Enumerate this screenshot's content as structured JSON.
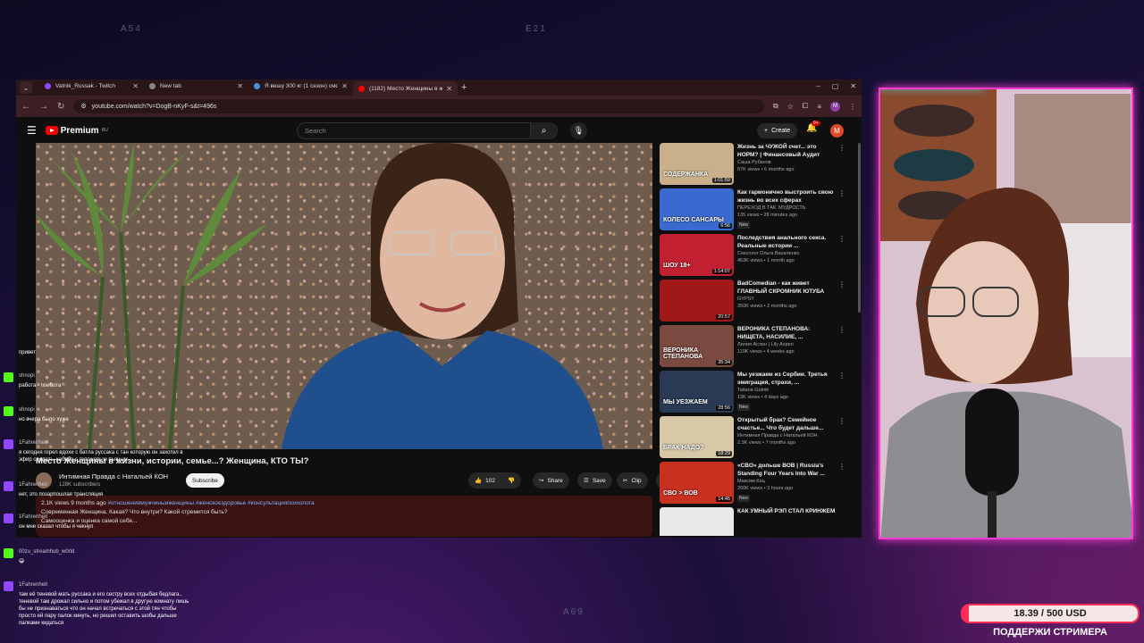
{
  "watermarks": {
    "top_left": "A54",
    "top_center": "E21",
    "bottom": "A69"
  },
  "browser": {
    "tabs": [
      {
        "label": "Vatnik_Russak - Twitch",
        "color": "#9146ff"
      },
      {
        "label": "New tab",
        "color": "#888888"
      },
      {
        "label": "Я вешу 300 кг (1 сезон) смотр",
        "color": "#4a90e2"
      },
      {
        "label": "(1182) Место Женщины в жи",
        "color": "#ff0000"
      }
    ],
    "url": "youtube.com/watch?v=DogB-nKyF-s&t=496s"
  },
  "youtube": {
    "logo": "Premium",
    "logo_sup": "RU",
    "search_placeholder": "Search",
    "create_label": "Create",
    "notif_count": "9+",
    "account_letter": "M"
  },
  "video": {
    "title": "Место Женщины в жизни, истории, семье...? Женщина, КТО ТЫ?",
    "channel": "Интимная Правда с Натальей КОН",
    "subscribers": "128K subscribers",
    "subscribe_label": "Subscribe",
    "likes": "102",
    "share_label": "Share",
    "save_label": "Save",
    "clip_label": "Clip",
    "desc_stats": "2.1K views  9 months ago",
    "desc_tags": "#отношениямужчиныиженщины #женскоездоровье #консультацияпсихолога",
    "desc_line1": "Современная Женщина. Какая? Что внутри? Какой стремится быть?",
    "desc_line2": "Самооценка и оценка самой себя..."
  },
  "related": [
    {
      "title": "Жизнь за ЧУЖОЙ счет... это НОРМ? | Финансовый Аудит",
      "channel": "Саша Рубанов",
      "views": "57K views • 6 months ago",
      "duration": "1:01:59",
      "thumb_text": "СОДЕРЖАНКА",
      "bg": "#c9b08a",
      "new": false
    },
    {
      "title": "Как гармонично выстроить свою жизнь во всех сферах",
      "channel": "ПЕРЕХОД В ТАК. МУДРОСТЬ",
      "views": "135 views • 28 minutes ago",
      "duration": "6:56",
      "thumb_text": "КОЛЕСО САНСАРЫ",
      "bg": "#3a6ad0",
      "new": true
    },
    {
      "title": "Последствия анального секса. Реальные истории ...",
      "channel": "Сексолог Ольга Василенко",
      "views": "453K views • 1 month ago",
      "duration": "1:14:07",
      "thumb_text": "ШОУ 18+",
      "bg": "#c02030",
      "new": false
    },
    {
      "title": "BadComedian - как живет ГЛАВНЫЙ СКРОМНИК ЮТУБА",
      "channel": "GYPSY",
      "views": "350K views • 2 months ago",
      "duration": "20:57",
      "thumb_text": "",
      "bg": "#a01818",
      "new": false
    },
    {
      "title": "ВЕРОНИКА СТЕПАНОВА: НИЩЕТА, НАСИЛИЕ, ...",
      "channel": "Лилия Аслен | Lily Aspen",
      "views": "110K views • 4 weeks ago",
      "duration": "35:34",
      "thumb_text": "ВЕРОНИКА СТЕПАНОВА",
      "bg": "#7a4a40",
      "new": false
    },
    {
      "title": "Мы уезжаем из Сербии. Третья эмиграция, страхи, ...",
      "channel": "Tatiana Gutnik",
      "views": "13K views • 4 days ago",
      "duration": "28:56",
      "thumb_text": "МЫ УЕЗЖАЕМ",
      "bg": "#2a3a55",
      "new": true
    },
    {
      "title": "Открытый брак? Семейное счастье... Что будет дальше...",
      "channel": "Интимная Правда с Натальей КОН",
      "views": "2.3K views • 7 months ago",
      "duration": "18:29",
      "thumb_text": "БРАК НАДО?",
      "bg": "#d8c8a8",
      "new": false
    },
    {
      "title": "«СВО» дольше ВОВ | Russia's Standing Four Years Into War ...",
      "channel": "Максим Кац",
      "views": "200K views • 3 hours ago",
      "duration": "14:45",
      "thumb_text": "СВО > ВОВ",
      "bg": "#c83020",
      "new": true
    },
    {
      "title": "КАК УМНЫЙ РЭП СТАЛ КРИНЖЕМ",
      "channel": "",
      "views": "",
      "duration": "",
      "thumb_text": "",
      "bg": "#e8e8e8",
      "new": false
    }
  ],
  "chat": [
    {
      "user": "",
      "text": "привет",
      "badge": "none"
    },
    {
      "user": "shnopi",
      "text": "работа - поебота",
      "badge": "kick"
    },
    {
      "user": "shnopi",
      "text": "но вчера было хуже",
      "badge": "kick"
    },
    {
      "user": "1Fahrenheit",
      "text": "я сегодня горел вдохи с батла руссака с тан которую он захотел в эфир сделать, кабаба с голожопым пьяным...",
      "badge": "twitch"
    },
    {
      "user": "1Fahrenheit",
      "text": "нет, это позарпошлая трансляция",
      "badge": "twitch"
    },
    {
      "user": "1Fahrenheit",
      "text": "он мне сказал чтобы я чекнул",
      "badge": "twitch"
    },
    {
      "user": "00zu_streamhub_w0rld",
      "text": "😁",
      "badge": "kick"
    },
    {
      "user": "1Fahrenheit",
      "text": "там её теневой мать руссака и его сестру всех отдыбая бедлага.. теневой там дрожал сильно и потом убежал в другую комнату лишь бы не признаваться что он начал встречаться с этой тян чтобы просто ей пару палок кинуть, но решил оставить шобы дальше палками кидаться",
      "badge": "twitch"
    }
  ],
  "donation": {
    "amount_text": "18.39 / 500 USD",
    "progress": 0.037,
    "label": "ПОДДЕРЖИ СТРИМЕРА"
  },
  "colors": {
    "twitch": "#9146ff",
    "kick": "#53fc18",
    "neon_pink": "#ff3bd4",
    "neon_cyan": "#3fe9ff",
    "yt_red": "#ff0000"
  }
}
